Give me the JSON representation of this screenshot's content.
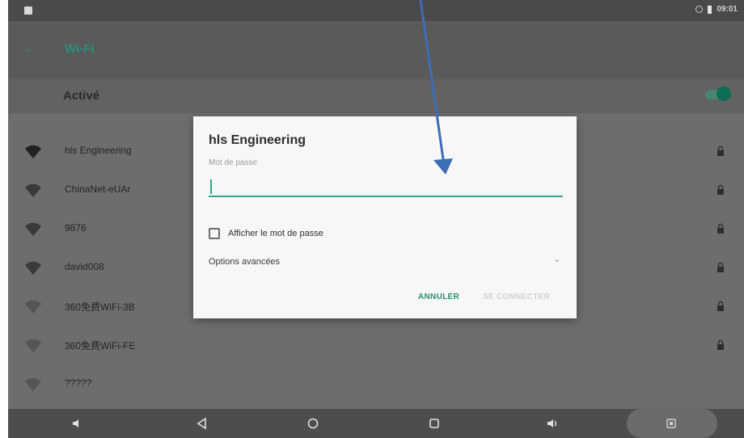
{
  "status_bar": {
    "time": "09:01",
    "left_icon": "notification-icon",
    "wifi_icon": "wifi-status-icon",
    "battery_icon": "battery-icon"
  },
  "app_bar": {
    "back_icon": "back-arrow-icon",
    "title": "Wi-Fi"
  },
  "master_switch": {
    "label": "Activé",
    "state": "on",
    "accent": "#0f6e56"
  },
  "networks": [
    {
      "name": "hls Engineering",
      "signal": 4,
      "locked": true
    },
    {
      "name": "ChinaNet-eUAr",
      "signal": 3,
      "locked": true
    },
    {
      "name": "9876",
      "signal": 3,
      "locked": true
    },
    {
      "name": "david008",
      "signal": 3,
      "locked": true
    },
    {
      "name": "360免费WiFi-3B",
      "signal": 2,
      "locked": true
    },
    {
      "name": "360免费WiFi-FE",
      "signal": 2,
      "locked": true
    },
    {
      "name": "?????",
      "signal": 2,
      "locked": false
    }
  ],
  "dialog": {
    "title": "hls Engineering",
    "password_label": "Mot de passe",
    "password_value": "",
    "show_password_label": "Afficher le mot de passe",
    "show_password_checked": false,
    "advanced_label": "Options avancées",
    "cancel_label": "ANNULER",
    "connect_label": "SE CONNECTER",
    "accent": "#33a58b"
  },
  "nav_bar": {
    "icons": [
      "volume-down-icon",
      "back-triangle-icon",
      "home-circle-icon",
      "recents-square-icon",
      "volume-up-icon",
      "screenshot-icon"
    ]
  },
  "colors": {
    "annotation_arrow": "#3b6eb5"
  }
}
